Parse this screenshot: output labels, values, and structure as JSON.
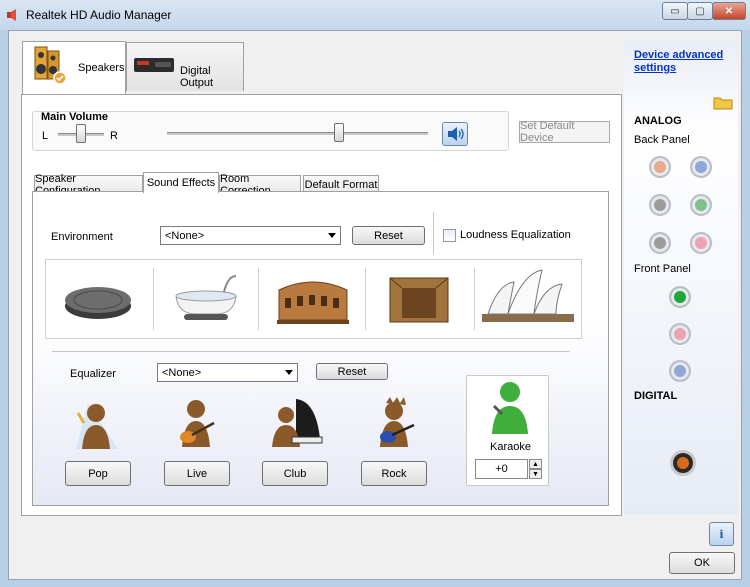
{
  "window": {
    "title": "Realtek HD Audio Manager",
    "minimize": "▭",
    "maximize": "▢",
    "close": "✕"
  },
  "device_tabs": [
    {
      "label": "Speakers",
      "selected": true
    },
    {
      "label": "Digital Output",
      "selected": false
    }
  ],
  "main_volume": {
    "title": "Main Volume",
    "left_label": "L",
    "right_label": "R",
    "balance": 0.5,
    "level": 0.66
  },
  "set_default_label": "Set Default Device",
  "sub_tabs": [
    {
      "label": "Speaker Configuration"
    },
    {
      "label": "Sound Effects",
      "selected": true
    },
    {
      "label": "Room Correction"
    },
    {
      "label": "Default Format"
    }
  ],
  "environment": {
    "label": "Environment",
    "selected": "<None>",
    "reset_label": "Reset",
    "loudness_label": "Loudness Equalization",
    "loudness_checked": false,
    "icons": [
      "sewer-lid-icon",
      "bathtub-icon",
      "colosseum-icon",
      "stone-room-icon",
      "opera-house-icon"
    ]
  },
  "equalizer": {
    "label": "Equalizer",
    "selected": "<None>",
    "reset_label": "Reset",
    "presets": [
      {
        "label": "Pop",
        "icon": "pop-singer-icon"
      },
      {
        "label": "Live",
        "icon": "live-guitar-icon"
      },
      {
        "label": "Club",
        "icon": "club-piano-icon"
      },
      {
        "label": "Rock",
        "icon": "rock-guitar-icon"
      }
    ]
  },
  "karaoke": {
    "label": "Karaoke",
    "value": "+0"
  },
  "right_panel": {
    "device_link": "Device advanced settings",
    "analog": "ANALOG",
    "back_panel": "Back Panel",
    "front_panel": "Front Panel",
    "digital": "DIGITAL",
    "back_jacks": [
      "#e9a98d",
      "#8fa6d6",
      "#9c9c9c",
      "#7fc18a",
      "#9c9c9c",
      "#e9a3b3"
    ],
    "front_jacks": [
      "#1fa53a",
      "#e9a3b3",
      "#8fa6d6"
    ]
  },
  "ok_label": "OK",
  "info_label": "i"
}
